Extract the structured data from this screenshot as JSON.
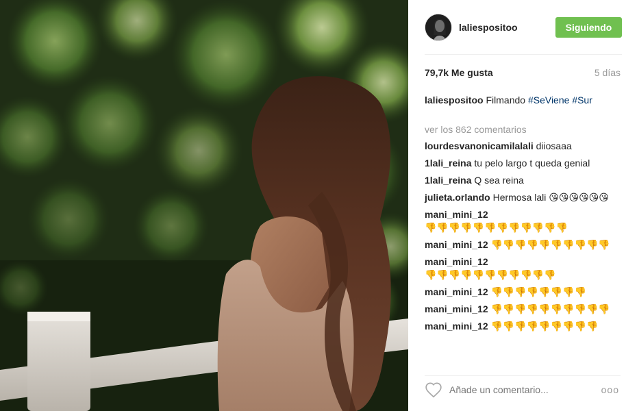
{
  "post": {
    "username": "laliespositoo",
    "follow_label": "Siguiendo",
    "likes": "79,7k Me gusta",
    "time": "5 días",
    "caption": {
      "text": "Filmando",
      "tags": [
        "#SeViene",
        "#Sur"
      ]
    },
    "view_all": "ver los 862 comentarios"
  },
  "comments": [
    {
      "user": "lourdesvanonicamilalali",
      "text": "diiosaaa"
    },
    {
      "user": "1lali_reina",
      "text": "tu pelo largo t queda genial"
    },
    {
      "user": "1lali_reina",
      "text": "Q sea reina"
    },
    {
      "user": "julieta.orlando",
      "text": "Hermosa lali",
      "emoji": "😘😘😘😘😘😘"
    },
    {
      "user": "mani_mini_12",
      "emoji": "👎👎👎👎👎👎👎👎👎👎👎👎"
    },
    {
      "user": "mani_mini_12",
      "emoji": "👎👎👎👎👎👎👎👎👎👎"
    },
    {
      "user": "mani_mini_12",
      "emoji": "👎👎👎👎👎👎👎👎👎👎👎"
    },
    {
      "user": "mani_mini_12",
      "emoji": "👎👎👎👎👎👎👎👎"
    },
    {
      "user": "mani_mini_12",
      "emoji": "👎👎👎👎👎👎👎👎👎👎"
    },
    {
      "user": "mani_mini_12",
      "emoji": "👎👎👎👎👎👎👎👎👎"
    }
  ],
  "footer": {
    "placeholder": "Añade un comentario...",
    "more": "ooo"
  },
  "icons": {
    "heart": "heart-icon",
    "more": "more-options-icon"
  },
  "colors": {
    "follow_button": "#70c050",
    "hashtag": "#003569",
    "muted": "#999999"
  }
}
